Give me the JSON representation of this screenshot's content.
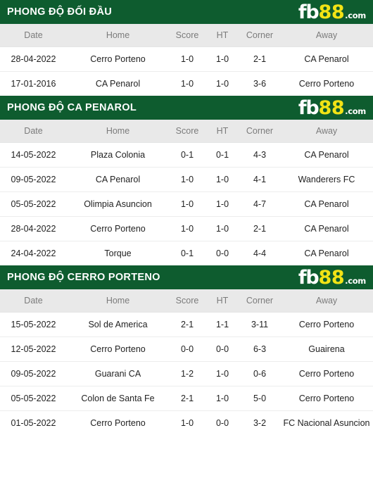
{
  "brand": {
    "logo_fb": "fb",
    "logo_88": "88",
    "logo_dotcom": ".com",
    "green": "#0e5c2f",
    "yellow": "#f2e315"
  },
  "colors": {
    "score": "#a03346",
    "team_blue": "#5a9bd4",
    "team_orange": "#e0815a",
    "header_bg": "#e9e9e9",
    "header_text": "#7b7b7b"
  },
  "columns": {
    "date": "Date",
    "home": "Home",
    "score": "Score",
    "ht": "HT",
    "corner": "Corner",
    "away": "Away"
  },
  "sections": [
    {
      "title": "PHONG ĐỘ ĐỐI ĐẦU",
      "rows": [
        {
          "date": "28-04-2022",
          "home": "Cerro Porteno",
          "home_style": "team-blue",
          "score": "1-0",
          "ht": "1-0",
          "corner": "2-1",
          "away": "CA Penarol",
          "away_style": "team-orange"
        },
        {
          "date": "17-01-2016",
          "home": "CA Penarol",
          "home_style": "team-orange",
          "score": "1-0",
          "ht": "1-0",
          "corner": "3-6",
          "away": "Cerro Porteno",
          "away_style": "team-blue"
        }
      ]
    },
    {
      "title": "PHONG ĐỘ CA PENAROL",
      "rows": [
        {
          "date": "14-05-2022",
          "home": "Plaza Colonia",
          "home_style": "team-plain",
          "score": "0-1",
          "ht": "0-1",
          "corner": "4-3",
          "away": "CA Penarol",
          "away_style": "team-orange"
        },
        {
          "date": "09-05-2022",
          "home": "CA Penarol",
          "home_style": "team-orange",
          "score": "1-0",
          "ht": "1-0",
          "corner": "4-1",
          "away": "Wanderers FC",
          "away_style": "team-plain"
        },
        {
          "date": "05-05-2022",
          "home": "Olimpia Asuncion",
          "home_style": "team-plain",
          "score": "1-0",
          "ht": "1-0",
          "corner": "4-7",
          "away": "CA Penarol",
          "away_style": "team-orange"
        },
        {
          "date": "28-04-2022",
          "home": "Cerro Porteno",
          "home_style": "team-plain",
          "score": "1-0",
          "ht": "1-0",
          "corner": "2-1",
          "away": "CA Penarol",
          "away_style": "team-orange"
        },
        {
          "date": "24-04-2022",
          "home": "Torque",
          "home_style": "team-plain",
          "score": "0-1",
          "ht": "0-0",
          "corner": "4-4",
          "away": "CA Penarol",
          "away_style": "team-orange"
        }
      ]
    },
    {
      "title": "PHONG ĐỘ CERRO PORTENO",
      "rows": [
        {
          "date": "15-05-2022",
          "home": "Sol de America",
          "home_style": "team-plain",
          "score": "2-1",
          "ht": "1-1",
          "corner": "3-11",
          "away": "Cerro Porteno",
          "away_style": "team-blue"
        },
        {
          "date": "12-05-2022",
          "home": "Cerro Porteno",
          "home_style": "team-blue",
          "score": "0-0",
          "ht": "0-0",
          "corner": "6-3",
          "away": "Guairena",
          "away_style": "team-plain"
        },
        {
          "date": "09-05-2022",
          "home": "Guarani CA",
          "home_style": "team-plain",
          "score": "1-2",
          "ht": "1-0",
          "corner": "0-6",
          "away": "Cerro Porteno",
          "away_style": "team-blue"
        },
        {
          "date": "05-05-2022",
          "home": "Colon de Santa Fe",
          "home_style": "team-plain",
          "score": "2-1",
          "ht": "1-0",
          "corner": "5-0",
          "away": "Cerro Porteno",
          "away_style": "team-blue"
        },
        {
          "date": "01-05-2022",
          "home": "Cerro Porteno",
          "home_style": "team-blue",
          "score": "1-0",
          "ht": "0-0",
          "corner": "3-2",
          "away": "FC Nacional Asuncion",
          "away_style": "team-plain"
        }
      ]
    }
  ]
}
